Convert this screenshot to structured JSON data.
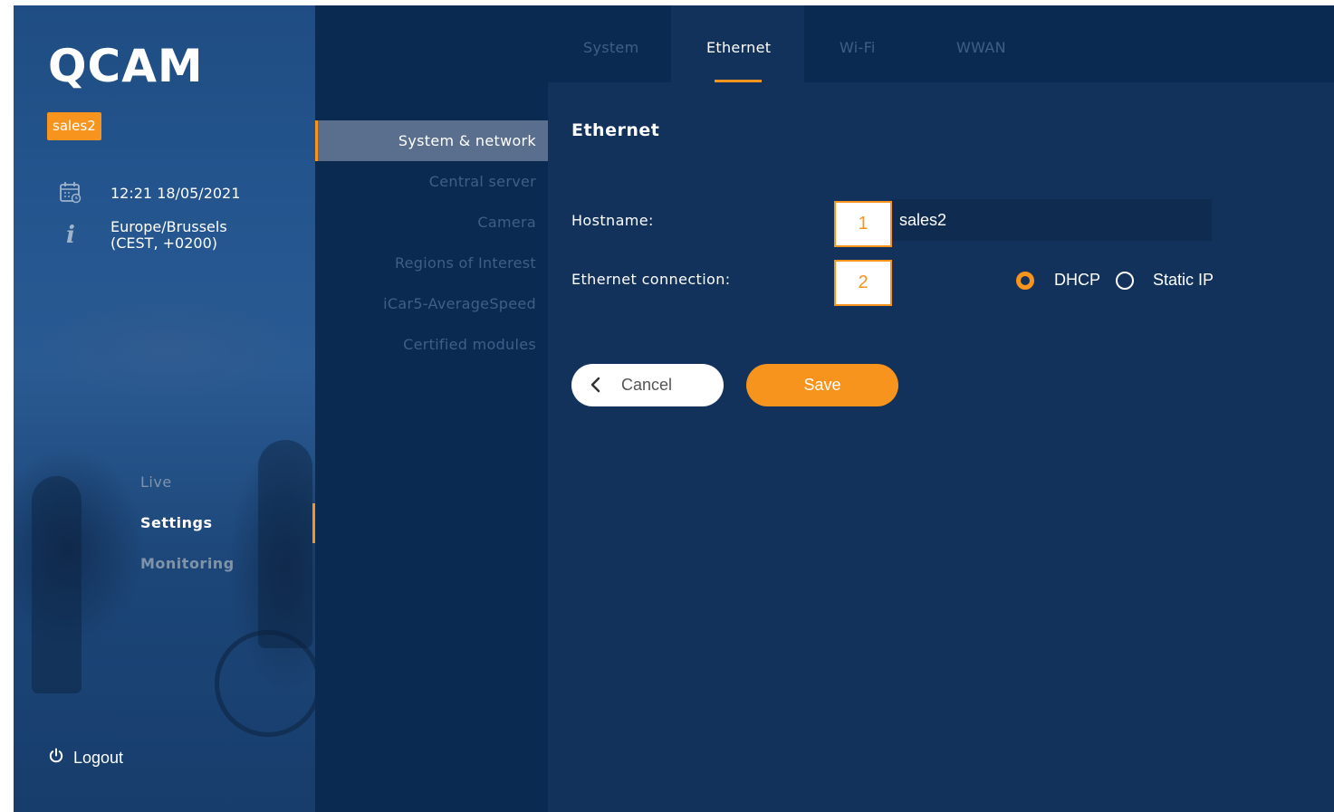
{
  "app": {
    "logo": "QCAM",
    "user_badge": "sales2"
  },
  "sidebar": {
    "datetime": "12:21 18/05/2021",
    "timezone_line1": "Europe/Brussels",
    "timezone_line2": "(CEST, +0200)",
    "nav": [
      {
        "label": "Live",
        "active": false
      },
      {
        "label": "Settings",
        "active": true
      },
      {
        "label": "Monitoring",
        "active": false
      }
    ],
    "logout_label": "Logout"
  },
  "subnav": {
    "items": [
      {
        "label": "System & network",
        "active": true
      },
      {
        "label": "Central server",
        "active": false
      },
      {
        "label": "Camera",
        "active": false
      },
      {
        "label": "Regions of Interest",
        "active": false
      },
      {
        "label": "iCar5-AverageSpeed",
        "active": false
      },
      {
        "label": "Certified modules",
        "active": false
      }
    ]
  },
  "tabs": [
    {
      "label": "System",
      "active": false
    },
    {
      "label": "Ethernet",
      "active": true
    },
    {
      "label": "Wi-Fi",
      "active": false
    },
    {
      "label": "WWAN",
      "active": false
    }
  ],
  "form": {
    "title": "Ethernet",
    "hostname_label": "Hostname:",
    "hostname_value": "sales2",
    "hostname_marker": "1",
    "connection_label": "Ethernet connection:",
    "connection_marker": "2",
    "connection_options": [
      {
        "label": "DHCP",
        "selected": true
      },
      {
        "label": "Static IP",
        "selected": false
      }
    ],
    "cancel_label": "Cancel",
    "save_label": "Save"
  },
  "colors": {
    "accent": "#f7941d",
    "background": "#12325c",
    "panel": "#0b2a52",
    "sidebar": "#24558e"
  },
  "icons": {
    "calendar": "calendar-icon",
    "info": "info-icon",
    "power": "power-icon",
    "back": "chevron-left-icon"
  }
}
